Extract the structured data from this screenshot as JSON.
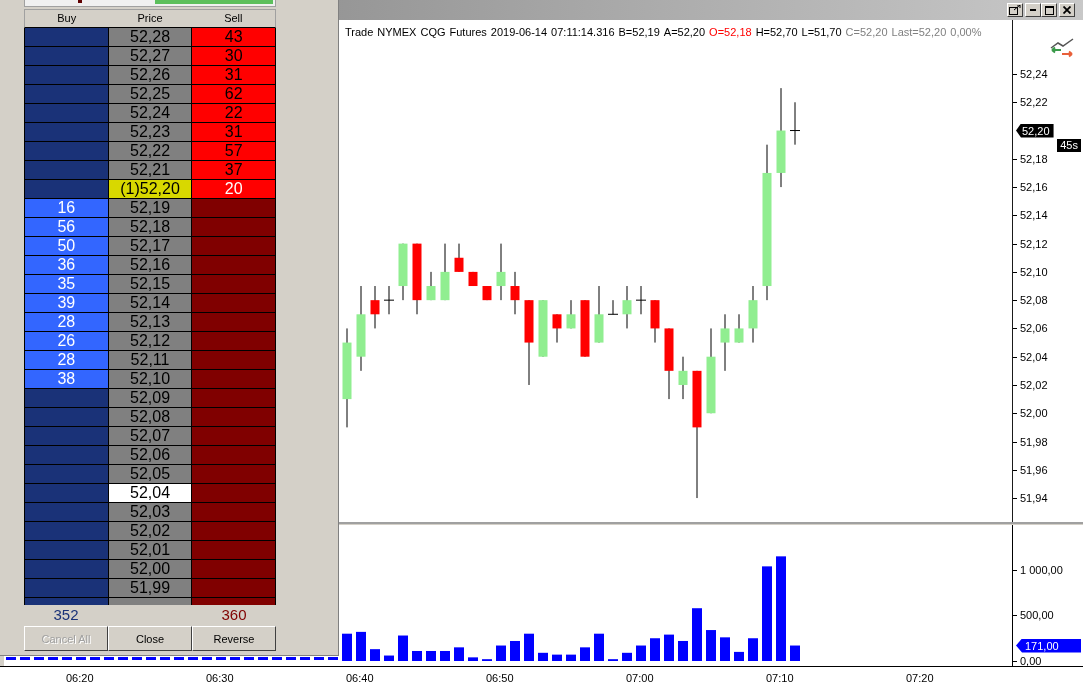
{
  "dom": {
    "columns": [
      "Buy",
      "Price",
      "Sell"
    ],
    "rows": [
      {
        "kind": "ask",
        "price": "52,28",
        "sell": "43",
        "marked": false
      },
      {
        "kind": "ask",
        "price": "52,27",
        "sell": "30",
        "marked": false
      },
      {
        "kind": "ask",
        "price": "52,26",
        "sell": "31",
        "marked": false
      },
      {
        "kind": "ask",
        "price": "52,25",
        "sell": "62",
        "marked": false
      },
      {
        "kind": "ask",
        "price": "52,24",
        "sell": "22",
        "marked": false
      },
      {
        "kind": "ask",
        "price": "52,23",
        "sell": "31",
        "marked": false
      },
      {
        "kind": "ask",
        "price": "52,22",
        "sell": "57",
        "marked": false
      },
      {
        "kind": "ask",
        "price": "52,21",
        "sell": "37",
        "marked": false
      },
      {
        "kind": "last",
        "price": "(1)52,20",
        "sell": "20",
        "marked": false
      },
      {
        "kind": "bid",
        "price": "52,19",
        "buy": "16",
        "marked": false
      },
      {
        "kind": "bid",
        "price": "52,18",
        "buy": "56",
        "marked": false
      },
      {
        "kind": "bid",
        "price": "52,17",
        "buy": "50",
        "marked": false
      },
      {
        "kind": "bid",
        "price": "52,16",
        "buy": "36",
        "marked": false
      },
      {
        "kind": "bid",
        "price": "52,15",
        "buy": "35",
        "marked": false
      },
      {
        "kind": "bid",
        "price": "52,14",
        "buy": "39",
        "marked": false
      },
      {
        "kind": "bid",
        "price": "52,13",
        "buy": "28",
        "marked": false
      },
      {
        "kind": "bid",
        "price": "52,12",
        "buy": "26",
        "marked": false
      },
      {
        "kind": "bid",
        "price": "52,11",
        "buy": "28",
        "marked": false
      },
      {
        "kind": "bid",
        "price": "52,10",
        "buy": "38",
        "marked": false
      },
      {
        "kind": "empty",
        "price": "52,09",
        "marked": false
      },
      {
        "kind": "empty",
        "price": "52,08",
        "marked": false
      },
      {
        "kind": "empty",
        "price": "52,07",
        "marked": false
      },
      {
        "kind": "empty",
        "price": "52,06",
        "marked": false
      },
      {
        "kind": "empty",
        "price": "52,05",
        "marked": false
      },
      {
        "kind": "empty",
        "price": "52,04",
        "marked": true
      },
      {
        "kind": "empty",
        "price": "52,03",
        "marked": false
      },
      {
        "kind": "empty",
        "price": "52,02",
        "marked": false
      },
      {
        "kind": "empty",
        "price": "52,01",
        "marked": false
      },
      {
        "kind": "empty",
        "price": "52,00",
        "marked": false
      },
      {
        "kind": "empty",
        "price": "51,99",
        "marked": false
      }
    ],
    "totals": {
      "buy": "352",
      "sell": "360"
    },
    "buttons": [
      {
        "label": "Cancel All",
        "disabled": true
      },
      {
        "label": "Close",
        "disabled": false
      },
      {
        "label": "Reverse",
        "disabled": false
      }
    ]
  },
  "chart": {
    "header": [
      {
        "text": "Trade",
        "kind": "plain"
      },
      {
        "text": "NYMEX",
        "kind": "plain"
      },
      {
        "text": "CQG",
        "kind": "plain"
      },
      {
        "text": "Futures",
        "kind": "plain"
      },
      {
        "text": "2019-06-14",
        "kind": "plain"
      },
      {
        "text": "07:11:14.316",
        "kind": "plain"
      },
      {
        "text": "B=52,19",
        "kind": "plain"
      },
      {
        "text": "A=52,20",
        "kind": "plain"
      },
      {
        "text": "O=52,18",
        "kind": "alert"
      },
      {
        "text": "H=52,70",
        "kind": "plain"
      },
      {
        "text": "L=51,70",
        "kind": "plain"
      },
      {
        "text": "C=52,20",
        "kind": "muted"
      },
      {
        "text": "Last=52,20",
        "kind": "muted"
      },
      {
        "text": "0,00%",
        "kind": "muted"
      }
    ],
    "price_axis": [
      {
        "kind": "tick",
        "label": "52,24"
      },
      {
        "kind": "tick",
        "label": "52,22"
      },
      {
        "kind": "current",
        "label": "52,20"
      },
      {
        "kind": "tick",
        "label": "52,18"
      },
      {
        "kind": "tick",
        "label": "52,16"
      },
      {
        "kind": "tick",
        "label": "52,14"
      },
      {
        "kind": "tick",
        "label": "52,12"
      },
      {
        "kind": "tick",
        "label": "52,10"
      },
      {
        "kind": "tick",
        "label": "52,08"
      },
      {
        "kind": "tick",
        "label": "52,06"
      },
      {
        "kind": "tick",
        "label": "52,04"
      },
      {
        "kind": "tick",
        "label": "52,02"
      },
      {
        "kind": "tick",
        "label": "52,00"
      },
      {
        "kind": "tick",
        "label": "51,98"
      },
      {
        "kind": "tick",
        "label": "51,96"
      },
      {
        "kind": "tick",
        "label": "51,94"
      }
    ],
    "timer": "45s"
  },
  "volume": {
    "current_volume": "171,00",
    "chart_data": {
      "type": "bar",
      "categories": [
        null,
        null,
        null,
        null,
        null,
        "06:20",
        null,
        null,
        null,
        null,
        null,
        null,
        null,
        null,
        null,
        "06:30",
        null,
        null,
        null,
        null,
        null,
        null,
        null,
        null,
        null,
        "06:40",
        null,
        null,
        null,
        null,
        null,
        null,
        null,
        null,
        null,
        "06:50",
        null,
        null,
        null,
        null,
        null,
        null,
        null,
        null,
        null,
        "07:00",
        null,
        null,
        null,
        null,
        null,
        null,
        null,
        null,
        null,
        "07:10",
        null,
        null,
        null,
        null,
        null,
        null,
        null,
        null,
        null,
        "07:20",
        null,
        null,
        null,
        null,
        null,
        null
      ],
      "series": [
        {
          "color": "#0000ff",
          "values": [
            null,
            null,
            null,
            null,
            null,
            null,
            null,
            null,
            null,
            null,
            null,
            null,
            null,
            null,
            null,
            null,
            null,
            null,
            null,
            null,
            null,
            null,
            null,
            null,
            300,
            320,
            130,
            60,
            280,
            110,
            110,
            110,
            150,
            40,
            20,
            170,
            220,
            300,
            90,
            70,
            70,
            150,
            300,
            20,
            90,
            170,
            250,
            290,
            220,
            580,
            340,
            260,
            100,
            250,
            1040,
            1150,
            170,
            null,
            null,
            null,
            null,
            null,
            null,
            null,
            null,
            null,
            null,
            null,
            null,
            null,
            null,
            null
          ]
        }
      ],
      "ylim": [
        -55,
        1494.5
      ],
      "yticks": [
        {
          "value": 1000,
          "label": "1 000,00"
        },
        {
          "value": 500,
          "label": "500,00"
        },
        {
          "value": 0,
          "label": "0,00"
        }
      ]
    }
  }
}
